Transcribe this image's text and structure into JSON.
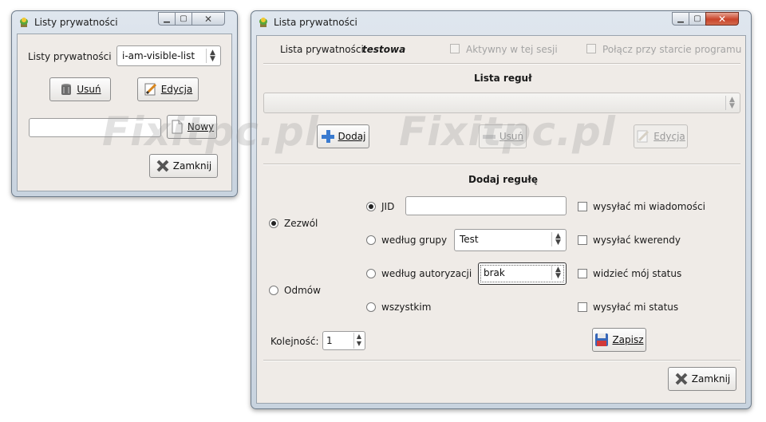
{
  "win1": {
    "title": "Listy prywatności",
    "list_label": "Listy prywatności",
    "list_value": "i-am-visible-list",
    "delete_btn": "Usuń",
    "edit_btn": "Edycja",
    "new_btn": "Nowy",
    "close_btn": "Zamknij"
  },
  "win2": {
    "title": "Lista prywatności",
    "list_label": "Lista prywatności",
    "list_name": "testowa",
    "active_session": "Aktywny w tej sesji",
    "connect_startup": "Połącz przy starcie programu",
    "rules_header": "Lista reguł",
    "add_btn": "Dodaj",
    "delete_btn": "Usuń",
    "edit_btn": "Edycja",
    "add_rule_header": "Dodaj regułę",
    "allow": "Zezwól",
    "deny": "Odmów",
    "jid": "JID",
    "by_group": "według grupy",
    "group_value": "Test",
    "by_auth": "według autoryzacji",
    "auth_value": "brak",
    "all": "wszystkim",
    "send_messages": "wysyłać mi wiadomości",
    "send_queries": "wysyłać kwerendy",
    "see_status": "widzieć mój status",
    "send_status": "wysyłać mi status",
    "order_label": "Kolejność:",
    "order_value": "1",
    "save_btn": "Zapisz",
    "close_btn": "Zamknij"
  },
  "watermark": "Fixitpc.pl"
}
